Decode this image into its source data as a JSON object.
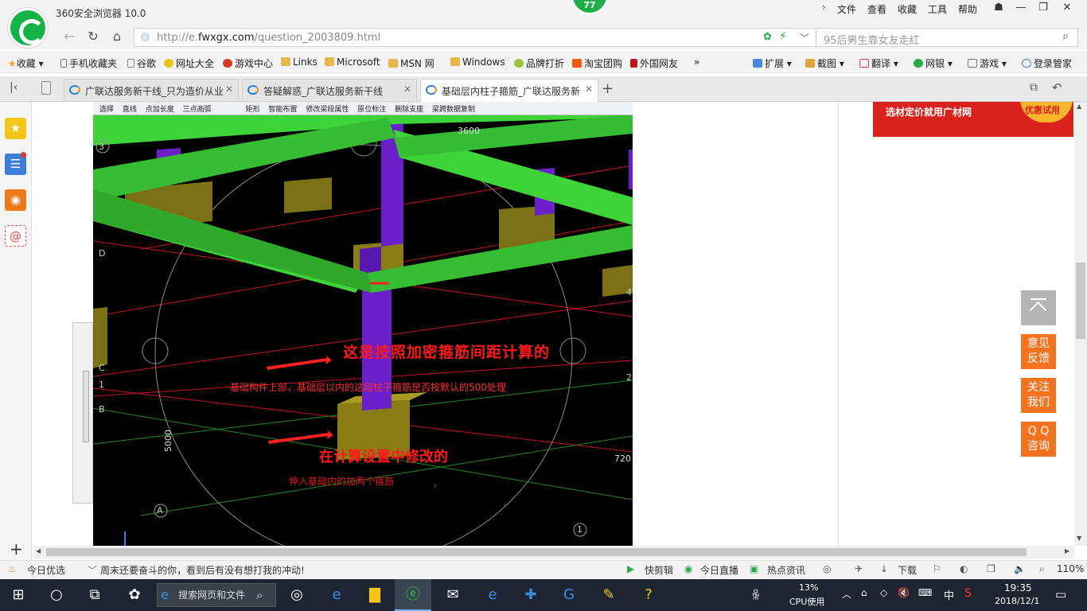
{
  "window": {
    "title": "360安全浏览器 10.0",
    "badge": "77",
    "menu": [
      "文件",
      "查看",
      "收藏",
      "工具",
      "帮助"
    ]
  },
  "address": {
    "url_prefix": "http://e.",
    "url_domain": "fwxgx.com",
    "url_path": "/question_2003809.html",
    "search_text": "95后男生靠女友走红"
  },
  "bookmarks": {
    "items": [
      "收藏",
      "手机收藏夹",
      "谷歌",
      "网址大全",
      "游戏中心",
      "Links",
      "Microsoft",
      "MSN 网",
      "Windows",
      "品牌打折",
      "淘宝团购",
      "外国网友"
    ],
    "more": "»",
    "right": [
      "扩展",
      "截图",
      "翻译",
      "网银",
      "游戏",
      "登录管家"
    ]
  },
  "tabs": [
    {
      "label": "广联达服务新干线_只为造价从业",
      "active": false
    },
    {
      "label": "答疑解惑_广联达服务新干线",
      "active": false
    },
    {
      "label": "基础层内柱子箍筋_广联达服务新",
      "active": true
    }
  ],
  "software": {
    "toolbar": [
      "选择",
      "直线",
      "点加长度",
      "三点画弧",
      "矩形",
      "智能布置",
      "修改梁段属性",
      "原位标注",
      "删除支座",
      "梁跨数据复制"
    ],
    "axis_labels": [
      "3",
      "D",
      "C",
      "1",
      "B",
      "A",
      "1",
      "2",
      "4"
    ],
    "dims": [
      "3600",
      "5000",
      "720"
    ],
    "ann1": "这是按照加密箍筋间距计算的",
    "ann2": "基础构件上部，基础层以内的这段柱子箍筋是否按默认的500处理",
    "ann3": "在计算设置中修改的",
    "ann4": "伸入基础内的加两个箍筋"
  },
  "ad": {
    "text": "选材定价就用广材网",
    "coin": "优惠试用"
  },
  "side_buttons": [
    "意见反馈",
    "关注我们",
    "Q Q咨询"
  ],
  "status": {
    "left": "今日优选",
    "news": "周末还要奋斗的你，看到后有没有想打我的冲动!",
    "items": [
      "快剪辑",
      "今日直播",
      "热点资讯",
      "下载"
    ],
    "zoom": "110%"
  },
  "taskbar": {
    "search": "搜索网页和文件",
    "cpu": "13%",
    "cpu_label": "CPU使用",
    "ime": "中",
    "time": "19:35",
    "date": "2018/12/1"
  }
}
